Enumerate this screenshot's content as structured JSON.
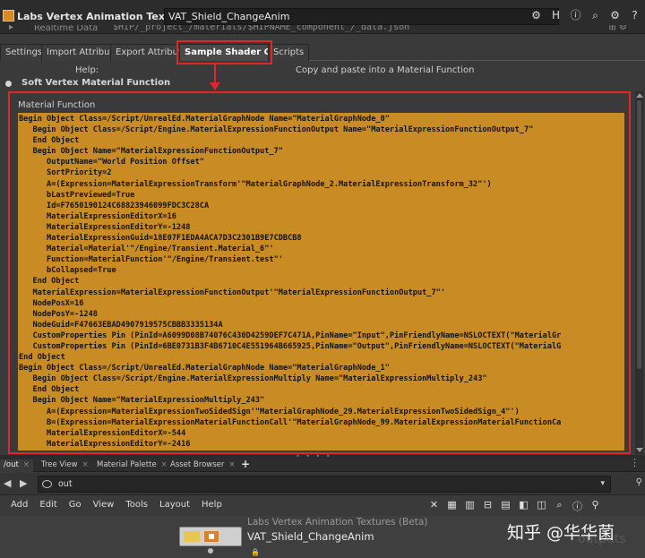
{
  "titlebar": {
    "node_type": "Labs Vertex Animation Textures (Beta)",
    "node_name": "VAT_Shield_ChangeAnim",
    "icons": [
      "gear-icon",
      "help-icon",
      "info-icon",
      "search-icon",
      "settings-icon",
      "help-circle-icon"
    ]
  },
  "realtime_row": {
    "label": "Realtime Data",
    "value": "$HIP/_project_/materials/$HIPNAME_component_/_data.json"
  },
  "tabs": [
    "Settings",
    "Import Attribute",
    "Export Attribute",
    "Sample Shader Code",
    "Scripts"
  ],
  "active_tab": "Sample Shader Code",
  "help": {
    "label": "Help:",
    "value": "Copy and paste into a Material Function"
  },
  "folder": {
    "label": "Soft Vertex Material Function"
  },
  "material_function": {
    "label": "Material Function",
    "code_lines": [
      "Begin Object Class=/Script/UnrealEd.MaterialGraphNode Name=\"MaterialGraphNode_0\"",
      "   Begin Object Class=/Script/Engine.MaterialExpressionFunctionOutput Name=\"MaterialExpressionFunctionOutput_7\"",
      "   End Object",
      "   Begin Object Name=\"MaterialExpressionFunctionOutput_7\"",
      "      OutputName=\"World Position Offset\"",
      "      SortPriority=2",
      "      A=(Expression=MaterialExpressionTransform'\"MaterialGraphNode_2.MaterialExpressionTransform_32\"')",
      "      bLastPreviewed=True",
      "      Id=F7650190124C68823946099FDC3C28CA",
      "      MaterialExpressionEditorX=16",
      "      MaterialExpressionEditorY=-1248",
      "      MaterialExpressionGuid=18E07F1EDA4ACA7D3C2301B9E7CDBCB8",
      "      Material=Material'\"/Engine/Transient.Material_6\"'",
      "      Function=MaterialFunction'\"/Engine/Transient.test\"'",
      "      bCollapsed=True",
      "   End Object",
      "   MaterialExpression=MaterialExpressionFunctionOutput'\"MaterialExpressionFunctionOutput_7\"'",
      "   NodePosX=16",
      "   NodePosY=-1248",
      "   NodeGuid=F47663EBAD4907919575CBBB3335134A",
      "   CustomProperties Pin (PinId=A6099D08B74076C430D4259DEF7C471A,PinName=\"Input\",PinFriendlyName=NSLOCTEXT(\"MaterialGr",
      "   CustomProperties Pin (PinId=6BE0731B3F4B6710C4E551964B665925,PinName=\"Output\",PinFriendlyName=NSLOCTEXT(\"MaterialG",
      "End Object",
      "Begin Object Class=/Script/UnrealEd.MaterialGraphNode Name=\"MaterialGraphNode_1\"",
      "   Begin Object Class=/Script/Engine.MaterialExpressionMultiply Name=\"MaterialExpressionMultiply_243\"",
      "   End Object",
      "   Begin Object Name=\"MaterialExpressionMultiply_243\"",
      "      A=(Expression=MaterialExpressionTwoSidedSign'\"MaterialGraphNode_29.MaterialExpressionTwoSidedSign_4\"')",
      "      B=(Expression=MaterialExpressionMaterialFunctionCall'\"MaterialGraphNode_99.MaterialExpressionMaterialFunctionCa",
      "      MaterialExpressionEditorX=-544",
      "      MaterialExpressionEditorY=-2416"
    ]
  },
  "pane_tabs": [
    "/out",
    "Tree View",
    "Material Palette",
    "Asset Browser"
  ],
  "pathbar": {
    "path": "out"
  },
  "menu": [
    "Add",
    "Edit",
    "Go",
    "View",
    "Tools",
    "Layout",
    "Help"
  ],
  "network": {
    "node_type": "Labs Vertex Animation Textures (Beta)",
    "node_name": "VAT_Shield_ChangeAnim"
  },
  "watermark": "知乎 @华华菌",
  "ghost_text": "outputs",
  "colors": {
    "code_background": "#c98b23",
    "highlight_red": "#e0262a",
    "node_orange": "#d98a20"
  }
}
